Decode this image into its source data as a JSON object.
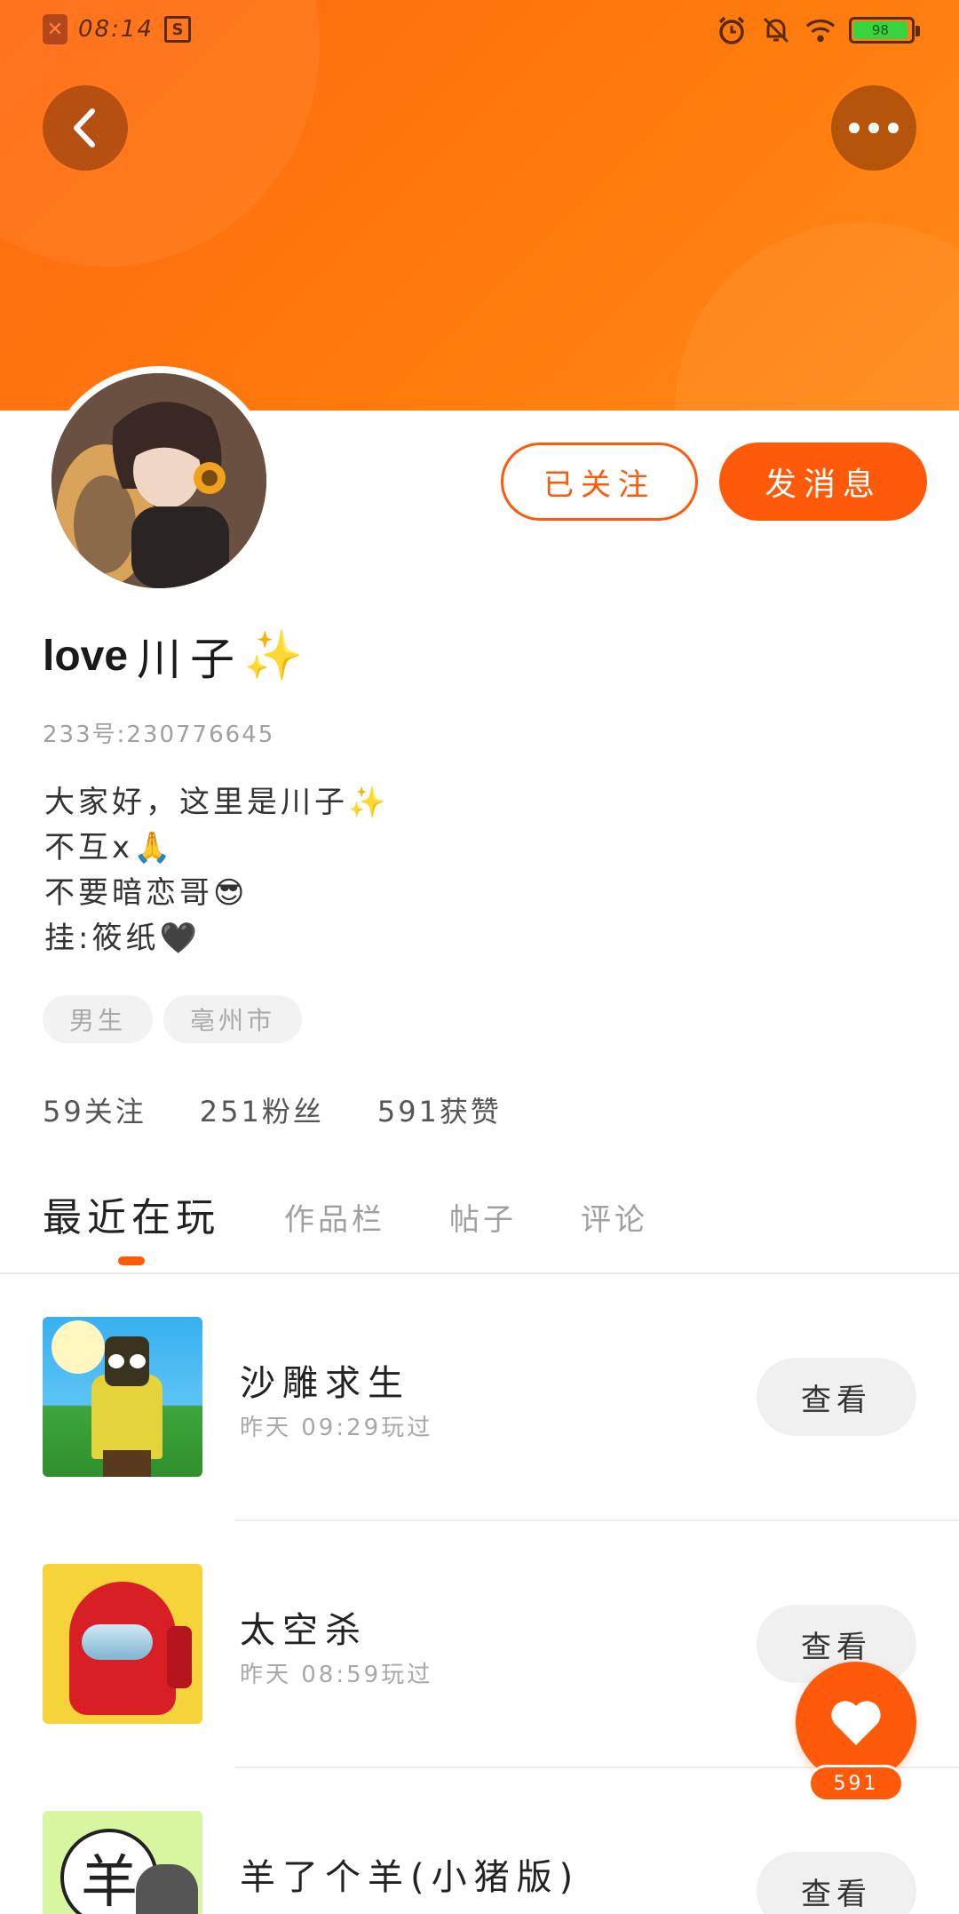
{
  "status_bar": {
    "time": "08:14",
    "battery": "98",
    "colors": {
      "battery_fill": "#39d33f"
    }
  },
  "header": {
    "colors": {
      "banner": "#ff7a0c",
      "accent": "#ff5a0a"
    }
  },
  "profile": {
    "name_latin": "love",
    "name_cn": "川子",
    "name_emoji": "✨",
    "uid": "233号:230776645",
    "bio_lines": [
      "大家好，这里是川子✨",
      "不互x🙏",
      "不要暗恋哥😎",
      "挂:筱纸🖤"
    ],
    "tags": [
      "男生",
      "亳州市"
    ],
    "stats": {
      "following": "59关注",
      "followers": "251粉丝",
      "likes": "591获赞"
    }
  },
  "actions": {
    "followed_label": "已关注",
    "message_label": "发消息"
  },
  "tabs": [
    {
      "label": "最近在玩",
      "active": true
    },
    {
      "label": "作品栏",
      "active": false
    },
    {
      "label": "帖子",
      "active": false
    },
    {
      "label": "评论",
      "active": false
    }
  ],
  "games": [
    {
      "title": "沙雕求生",
      "sub": "昨天 09:29玩过",
      "button": "查看"
    },
    {
      "title": "太空杀",
      "sub": "昨天 08:59玩过",
      "button": "查看"
    },
    {
      "title": "羊了个羊(小猪版)",
      "sub": "",
      "button": "查看"
    }
  ],
  "like_fab": {
    "count": "591"
  }
}
